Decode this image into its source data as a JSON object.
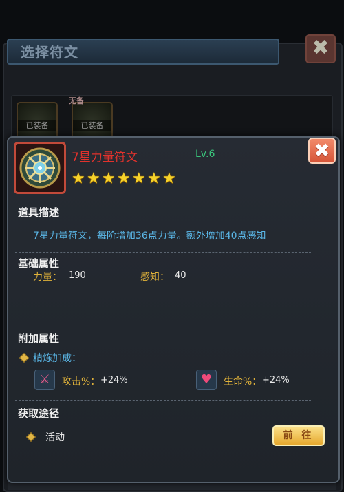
{
  "background": {
    "title": "选择符文",
    "slot_badge": "已装备",
    "tag": "无备",
    "close_icon": "✖"
  },
  "item": {
    "name": "7星力量符文",
    "level": "Lv.6",
    "stars": 7,
    "icon": "rune-icon"
  },
  "close_label": "✖",
  "sections": {
    "description_title": "道具描述",
    "description": "7星力量符文，每阶增加36点力量。额外增加40点感知",
    "base_title": "基础属性",
    "extra_title": "附加属性",
    "source_title": "获取途径"
  },
  "base_stats": [
    {
      "label": "力量：",
      "value": "190"
    },
    {
      "label": "感知：",
      "value": "40"
    }
  ],
  "refine": {
    "label": "精炼加成：",
    "attrs": [
      {
        "label": "攻击%：",
        "value": "+24%",
        "icon": "sword-icon"
      },
      {
        "label": "生命%：",
        "value": "+24%",
        "icon": "heart-icon"
      }
    ]
  },
  "source": {
    "item": "活动",
    "button": "前 往"
  },
  "colors": {
    "item_name": "#e2322c",
    "level": "#39c37a",
    "accent_blue": "#5ab6e6",
    "stat_label": "#e0b23a"
  }
}
